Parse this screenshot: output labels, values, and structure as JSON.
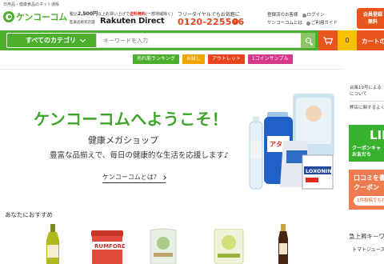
{
  "header": {
    "tagline": "日用品・健康食品のネット通販",
    "logo_text": "ケンコーコム",
    "shipping": {
      "prefix": "税込",
      "amount": "2,500円",
      "middle": "以上お買い上げで",
      "free": "送料無料",
      "note": "(一部地域除く)"
    },
    "rakuten_sub": "医薬品販売店舗",
    "rakuten_brand": "Rakuten Direct",
    "phone_label": "フリーダイヤルでもお気軽に",
    "phone_number": "0120-225566",
    "links": {
      "register": "登録済のお客様",
      "login": "ログイン",
      "about": "ケンコーコムとは",
      "guide": "ご利用ガイド"
    },
    "member_button": {
      "line1": "会員登録",
      "line2": "無料"
    }
  },
  "nav": {
    "category_button": "すべてのカテゴリ",
    "search_placeholder": "キーワードを入力",
    "cart_count": "0",
    "cart_label": "カートの中"
  },
  "tags": [
    {
      "label": "売れ筋ランキング",
      "color": "#4caf2c"
    },
    {
      "label": "お試し",
      "color": "#f0a400"
    },
    {
      "label": "アウトレット",
      "color": "#e8451e"
    },
    {
      "label": "1コインサンプル",
      "color": "#d6388e"
    }
  ],
  "hero": {
    "title": "ケンコーコムへようこそ！",
    "subtitle": "健康メガショップ",
    "description": "豊富な品揃えで、毎日の健康的な生活を応援します♪",
    "link": "ケンコーコムとは？"
  },
  "hero_products": {
    "detergent_label": "アタック",
    "box_brand": "LOXONIN"
  },
  "sidebar": {
    "news": [
      "台風19号による",
      "について",
      "弊店に関するよく"
    ],
    "line_banner": {
      "title": "LIN",
      "text": "クーポンキャ",
      "text2": "お友だち"
    },
    "review_banner": {
      "line1": "口コミを書",
      "line2": "クーポン",
      "pill": "1件投稿でもれなく"
    }
  },
  "recommend": {
    "title": "あなたにおすすめ",
    "products": [
      "オリーブオイル",
      "RUMFORD",
      "パック",
      "せっけん",
      "しょうゆ"
    ],
    "rumford_label": "RUMFORD"
  },
  "ranking": {
    "title": "急上昇キーワ",
    "item": "トマトジュース"
  },
  "colors": {
    "brand_green": "#4caf2c",
    "accent_orange": "#e8561e",
    "phone_orange": "#e8451e",
    "cart_yellow": "#f6c100"
  }
}
